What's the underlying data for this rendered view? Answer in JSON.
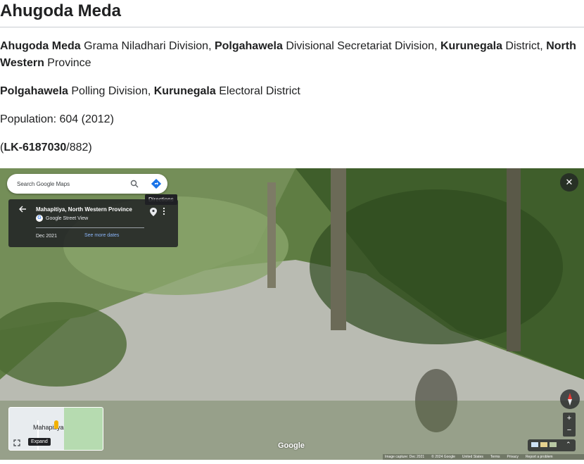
{
  "title": "Ahugoda Meda",
  "paragraph1": {
    "gn_name": "Ahugoda Meda",
    "gn_suffix": " Grama Niladhari Division, ",
    "ds_name": "Polgahawela",
    "ds_suffix": " Divisional Secretariat Division, ",
    "district_name": "Kurunegala",
    "district_suffix": " District, ",
    "province_name": "North Western",
    "province_suffix": " Province"
  },
  "paragraph2": {
    "polling_name": "Polgahawela",
    "polling_suffix": " Polling Division, ",
    "electoral_name": "Kurunegala",
    "electoral_suffix": " Electoral District"
  },
  "population_text": "Population: 604 (2012)",
  "code": {
    "open": "(",
    "id": "LK-6187030",
    "rest": "/882)"
  },
  "streetview": {
    "search_placeholder": "Search Google Maps",
    "directions_tooltip": "Directions",
    "place_name": "Mahapitiya, North Western Province",
    "source_label": "Google Street View",
    "capture_date": "Dec 2021",
    "see_more": "See more dates",
    "minimap_label": "Mahapitiya",
    "expand_label": "Expand",
    "google_logo": "Google",
    "footer": [
      "Image capture: Dec 2021",
      "© 2024 Google",
      "United States",
      "Terms",
      "Privacy",
      "Report a problem"
    ]
  }
}
